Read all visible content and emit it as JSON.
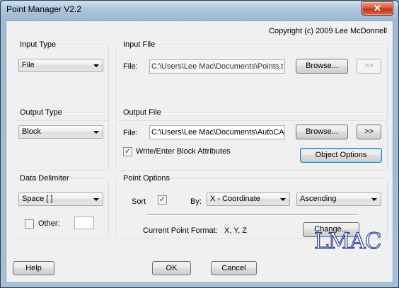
{
  "window": {
    "title": "Point Manager V2.2",
    "close_glyph": "✕",
    "copyright": "Copyright (c) 2009 Lee McDonnell"
  },
  "input_type": {
    "label": "Input Type",
    "value": "File"
  },
  "input_file": {
    "label": "Input File",
    "field_label": "File:",
    "value": "C:\\Users\\Lee Mac\\Documents\\Points.t",
    "browse": "Browse...",
    "arrow": ">>"
  },
  "output_type": {
    "label": "Output Type",
    "value": "Block"
  },
  "output_file": {
    "label": "Output File",
    "field_label": "File:",
    "value": "C:\\Users\\Lee Mac\\Documents\\AutoCA",
    "browse": "Browse...",
    "arrow": ">>",
    "attributes_label": "Write/Enter Block Attributes",
    "attributes_checked": true,
    "object_options": "Object Options"
  },
  "delimiter": {
    "label": "Data Delimiter",
    "value": "Space [  ]",
    "other_label": "Other:",
    "other_checked": false,
    "other_value": ""
  },
  "point_options": {
    "label": "Point Options",
    "sort_label": "Sort",
    "sort_checked": true,
    "by_label": "By:",
    "by_value": "X - Coordinate",
    "order_value": "Ascending",
    "format_label": "Current Point Format:",
    "format_value": "X, Y, Z",
    "change": "Change..."
  },
  "footer": {
    "help": "Help",
    "ok": "OK",
    "cancel": "Cancel",
    "logo": "LMAC"
  },
  "check_glyph": "✓"
}
